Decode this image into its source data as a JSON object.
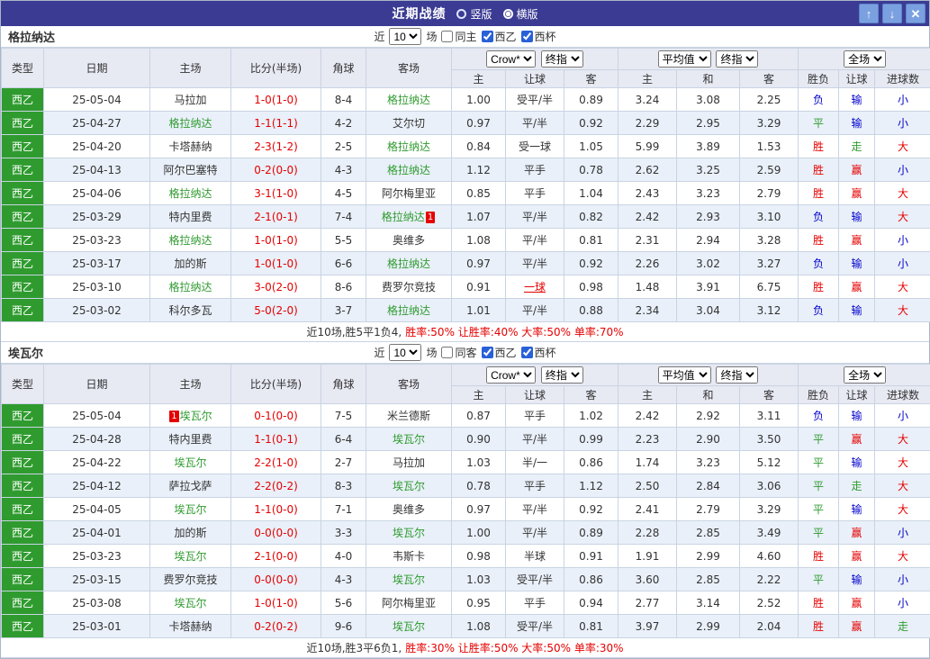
{
  "titlebar": {
    "title": "近期战绩",
    "vertical_label": "竖版",
    "horizontal_label": "横版",
    "icons": {
      "up": "↑",
      "down": "↓",
      "close": "✕"
    }
  },
  "colors": {
    "accent_green": "#2f9b2f",
    "accent_red": "#e60000",
    "accent_blue": "#0000cc",
    "titlebar_bg": "#3b3b94"
  },
  "table_head": {
    "type": "类型",
    "date": "日期",
    "home": "主场",
    "score": "比分(半场)",
    "corner": "角球",
    "away": "客场",
    "ah_home": "主",
    "ah_line": "让球",
    "ah_away": "客",
    "eu_home": "主",
    "eu_draw": "和",
    "eu_away": "客",
    "result": "胜负",
    "handicap": "让球",
    "goals": "进球数"
  },
  "sections": [
    {
      "team": "格拉纳达",
      "filter": {
        "near": "近",
        "count": "10",
        "games": "场",
        "same_label": "同主",
        "same_checked": false,
        "league_label": "西乙",
        "league_checked": true,
        "cup_label": "西杯",
        "cup_checked": true
      },
      "dropdowns": {
        "company": "Crow*",
        "ah_time": "终指",
        "eu_company": "平均值",
        "eu_time": "终指",
        "scope": "全场"
      },
      "rows": [
        {
          "type": "西乙",
          "date": "25-05-04",
          "home": "马拉加",
          "score": "1-0(1-0)",
          "corner": "8-4",
          "away": "格拉纳达",
          "away_hl": true,
          "ah": [
            "1.00",
            "受平/半",
            "0.89"
          ],
          "eu": [
            "3.24",
            "3.08",
            "2.25"
          ],
          "res": [
            "负",
            "输",
            "小"
          ]
        },
        {
          "type": "西乙",
          "date": "25-04-27",
          "home": "格拉纳达",
          "home_hl": true,
          "score": "1-1(1-1)",
          "corner": "4-2",
          "away": "艾尔切",
          "ah": [
            "0.97",
            "平/半",
            "0.92"
          ],
          "eu": [
            "2.29",
            "2.95",
            "3.29"
          ],
          "res": [
            "平",
            "输",
            "小"
          ]
        },
        {
          "type": "西乙",
          "date": "25-04-20",
          "home": "卡塔赫纳",
          "score": "2-3(1-2)",
          "corner": "2-5",
          "away": "格拉纳达",
          "away_hl": true,
          "ah": [
            "0.84",
            "受一球",
            "1.05"
          ],
          "eu": [
            "5.99",
            "3.89",
            "1.53"
          ],
          "res": [
            "胜",
            "走",
            "大"
          ]
        },
        {
          "type": "西乙",
          "date": "25-04-13",
          "home": "阿尔巴塞特",
          "score": "0-2(0-0)",
          "corner": "4-3",
          "away": "格拉纳达",
          "away_hl": true,
          "ah": [
            "1.12",
            "平手",
            "0.78"
          ],
          "eu": [
            "2.62",
            "3.25",
            "2.59"
          ],
          "res": [
            "胜",
            "赢",
            "小"
          ]
        },
        {
          "type": "西乙",
          "date": "25-04-06",
          "home": "格拉纳达",
          "home_hl": true,
          "score": "3-1(1-0)",
          "corner": "4-5",
          "away": "阿尔梅里亚",
          "ah": [
            "0.85",
            "平手",
            "1.04"
          ],
          "eu": [
            "2.43",
            "3.23",
            "2.79"
          ],
          "res": [
            "胜",
            "赢",
            "大"
          ]
        },
        {
          "type": "西乙",
          "date": "25-03-29",
          "home": "特内里费",
          "score": "2-1(0-1)",
          "corner": "7-4",
          "away": "格拉纳达",
          "away_hl": true,
          "away_badge": "1",
          "ah": [
            "1.07",
            "平/半",
            "0.82"
          ],
          "eu": [
            "2.42",
            "2.93",
            "3.10"
          ],
          "res": [
            "负",
            "输",
            "大"
          ]
        },
        {
          "type": "西乙",
          "date": "25-03-23",
          "home": "格拉纳达",
          "home_hl": true,
          "score": "1-0(1-0)",
          "corner": "5-5",
          "away": "奥维多",
          "ah": [
            "1.08",
            "平/半",
            "0.81"
          ],
          "eu": [
            "2.31",
            "2.94",
            "3.28"
          ],
          "res": [
            "胜",
            "赢",
            "小"
          ]
        },
        {
          "type": "西乙",
          "date": "25-03-17",
          "home": "加的斯",
          "score": "1-0(1-0)",
          "corner": "6-6",
          "away": "格拉纳达",
          "away_hl": true,
          "ah": [
            "0.97",
            "平/半",
            "0.92"
          ],
          "eu": [
            "2.26",
            "3.02",
            "3.27"
          ],
          "res": [
            "负",
            "输",
            "小"
          ]
        },
        {
          "type": "西乙",
          "date": "25-03-10",
          "home": "格拉纳达",
          "home_hl": true,
          "score": "3-0(2-0)",
          "corner": "8-6",
          "away": "费罗尔竞技",
          "ah": [
            "0.91",
            "一球",
            "0.98"
          ],
          "ah_red": true,
          "eu": [
            "1.48",
            "3.91",
            "6.75"
          ],
          "res": [
            "胜",
            "赢",
            "大"
          ]
        },
        {
          "type": "西乙",
          "date": "25-03-02",
          "home": "科尔多瓦",
          "score": "5-0(2-0)",
          "corner": "3-7",
          "away": "格拉纳达",
          "away_hl": true,
          "ah": [
            "1.01",
            "平/半",
            "0.88"
          ],
          "eu": [
            "2.34",
            "3.04",
            "3.12"
          ],
          "res": [
            "负",
            "输",
            "大"
          ]
        }
      ],
      "summary": {
        "record": "近10场,胜5平1负4,",
        "stats": "胜率:50% 让胜率:40% 大率:50% 单率:70%"
      }
    },
    {
      "team": "埃瓦尔",
      "filter": {
        "near": "近",
        "count": "10",
        "games": "场",
        "same_label": "同客",
        "same_checked": false,
        "league_label": "西乙",
        "league_checked": true,
        "cup_label": "西杯",
        "cup_checked": true
      },
      "dropdowns": {
        "company": "Crow*",
        "ah_time": "终指",
        "eu_company": "平均值",
        "eu_time": "终指",
        "scope": "全场"
      },
      "rows": [
        {
          "type": "西乙",
          "date": "25-05-04",
          "home": "埃瓦尔",
          "home_hl": true,
          "home_badge": "1",
          "score": "0-1(0-0)",
          "corner": "7-5",
          "away": "米兰德斯",
          "ah": [
            "0.87",
            "平手",
            "1.02"
          ],
          "eu": [
            "2.42",
            "2.92",
            "3.11"
          ],
          "res": [
            "负",
            "输",
            "小"
          ]
        },
        {
          "type": "西乙",
          "date": "25-04-28",
          "home": "特内里费",
          "score": "1-1(0-1)",
          "corner": "6-4",
          "away": "埃瓦尔",
          "away_hl": true,
          "ah": [
            "0.90",
            "平/半",
            "0.99"
          ],
          "eu": [
            "2.23",
            "2.90",
            "3.50"
          ],
          "res": [
            "平",
            "赢",
            "大"
          ]
        },
        {
          "type": "西乙",
          "date": "25-04-22",
          "home": "埃瓦尔",
          "home_hl": true,
          "score": "2-2(1-0)",
          "corner": "2-7",
          "away": "马拉加",
          "ah": [
            "1.03",
            "半/一",
            "0.86"
          ],
          "eu": [
            "1.74",
            "3.23",
            "5.12"
          ],
          "res": [
            "平",
            "输",
            "大"
          ]
        },
        {
          "type": "西乙",
          "date": "25-04-12",
          "home": "萨拉戈萨",
          "score": "2-2(0-2)",
          "corner": "8-3",
          "away": "埃瓦尔",
          "away_hl": true,
          "ah": [
            "0.78",
            "平手",
            "1.12"
          ],
          "eu": [
            "2.50",
            "2.84",
            "3.06"
          ],
          "res": [
            "平",
            "走",
            "大"
          ]
        },
        {
          "type": "西乙",
          "date": "25-04-05",
          "home": "埃瓦尔",
          "home_hl": true,
          "score": "1-1(0-0)",
          "corner": "7-1",
          "away": "奥维多",
          "ah": [
            "0.97",
            "平/半",
            "0.92"
          ],
          "eu": [
            "2.41",
            "2.79",
            "3.29"
          ],
          "res": [
            "平",
            "输",
            "大"
          ]
        },
        {
          "type": "西乙",
          "date": "25-04-01",
          "home": "加的斯",
          "score": "0-0(0-0)",
          "corner": "3-3",
          "away": "埃瓦尔",
          "away_hl": true,
          "ah": [
            "1.00",
            "平/半",
            "0.89"
          ],
          "eu": [
            "2.28",
            "2.85",
            "3.49"
          ],
          "res": [
            "平",
            "赢",
            "小"
          ]
        },
        {
          "type": "西乙",
          "date": "25-03-23",
          "home": "埃瓦尔",
          "home_hl": true,
          "score": "2-1(0-0)",
          "corner": "4-0",
          "away": "韦斯卡",
          "ah": [
            "0.98",
            "半球",
            "0.91"
          ],
          "eu": [
            "1.91",
            "2.99",
            "4.60"
          ],
          "res": [
            "胜",
            "赢",
            "大"
          ]
        },
        {
          "type": "西乙",
          "date": "25-03-15",
          "home": "费罗尔竞技",
          "score": "0-0(0-0)",
          "corner": "4-3",
          "away": "埃瓦尔",
          "away_hl": true,
          "ah": [
            "1.03",
            "受平/半",
            "0.86"
          ],
          "eu": [
            "3.60",
            "2.85",
            "2.22"
          ],
          "res": [
            "平",
            "输",
            "小"
          ]
        },
        {
          "type": "西乙",
          "date": "25-03-08",
          "home": "埃瓦尔",
          "home_hl": true,
          "score": "1-0(1-0)",
          "corner": "5-6",
          "away": "阿尔梅里亚",
          "ah": [
            "0.95",
            "平手",
            "0.94"
          ],
          "eu": [
            "2.77",
            "3.14",
            "2.52"
          ],
          "res": [
            "胜",
            "赢",
            "小"
          ]
        },
        {
          "type": "西乙",
          "date": "25-03-01",
          "home": "卡塔赫纳",
          "score": "0-2(0-2)",
          "corner": "9-6",
          "away": "埃瓦尔",
          "away_hl": true,
          "ah": [
            "1.08",
            "受平/半",
            "0.81"
          ],
          "eu": [
            "3.97",
            "2.99",
            "2.04"
          ],
          "res": [
            "胜",
            "赢",
            "走"
          ]
        }
      ],
      "summary": {
        "record": "近10场,胜3平6负1,",
        "stats": "胜率:30% 让胜率:50% 大率:50% 单率:30%"
      }
    }
  ]
}
